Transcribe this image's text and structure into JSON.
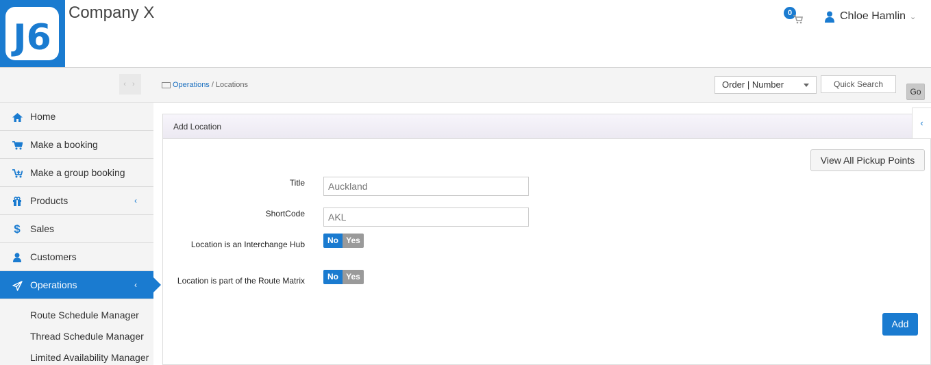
{
  "header": {
    "logo_text": "J6",
    "company_name": "Company X",
    "cart_count": "0",
    "user_name": "Chloe Hamlin"
  },
  "toolbar": {
    "breadcrumb_link": "Operations",
    "breadcrumb_separator": "/",
    "breadcrumb_current": "Locations",
    "search_type_value": "Order | Number",
    "quick_search_placeholder": "Quick Search",
    "go_label": "Go"
  },
  "sidebar": {
    "items": [
      {
        "label": "Home",
        "icon": "home-icon"
      },
      {
        "label": "Make a booking",
        "icon": "cart-icon"
      },
      {
        "label": "Make a group booking",
        "icon": "cart-plus-icon"
      },
      {
        "label": "Products",
        "icon": "gift-icon"
      },
      {
        "label": "Sales",
        "icon": "dollar-icon"
      },
      {
        "label": "Customers",
        "icon": "user-icon"
      },
      {
        "label": "Operations",
        "icon": "paper-plane-icon"
      }
    ],
    "sub_items": [
      {
        "label": "Route Schedule Manager"
      },
      {
        "label": "Thread Schedule Manager"
      },
      {
        "label": "Limited Availability Manager"
      }
    ]
  },
  "panel": {
    "title": "Add Location",
    "view_all_label": "View All Pickup Points",
    "fields": {
      "title_label": "Title",
      "title_placeholder": "Auckland",
      "shortcode_label": "ShortCode",
      "shortcode_placeholder": "AKL",
      "interchange_label": "Location is an Interchange Hub",
      "route_matrix_label": "Location is part of the Route Matrix"
    },
    "toggle_no": "No",
    "toggle_yes": "Yes",
    "add_label": "Add"
  },
  "colors": {
    "primary": "#1a7bd0",
    "sidebar_bg": "#f4f4f4"
  }
}
